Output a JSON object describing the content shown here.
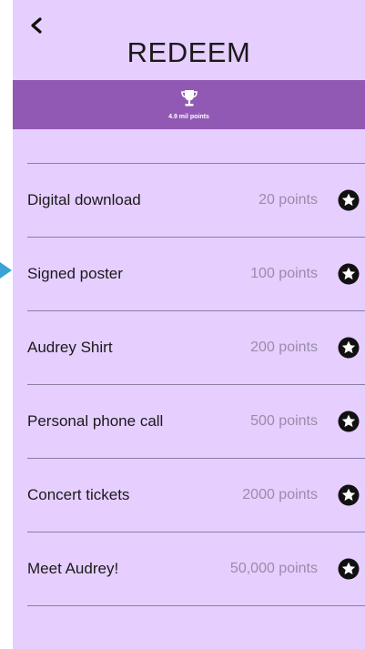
{
  "header": {
    "title": "REDEEM",
    "back_icon": "chevron-left-icon"
  },
  "banner": {
    "icon": "trophy-icon",
    "points_total": "4.9 mil points",
    "color": "#9159b3"
  },
  "rewards": [
    {
      "name": "Digital download",
      "points": "20 points",
      "icon": "star-icon"
    },
    {
      "name": "Signed poster",
      "points": "100 points",
      "icon": "star-icon"
    },
    {
      "name": "Audrey Shirt",
      "points": "200 points",
      "icon": "star-icon"
    },
    {
      "name": "Personal phone call",
      "points": "500 points",
      "icon": "star-icon"
    },
    {
      "name": "Concert tickets",
      "points": "2000 points",
      "icon": "star-icon"
    },
    {
      "name": "Meet Audrey!",
      "points": "50,000 points",
      "icon": "star-icon"
    }
  ],
  "colors": {
    "background": "#e6ceff",
    "accent": "#9159b3",
    "pointer": "#3aa3d6"
  }
}
